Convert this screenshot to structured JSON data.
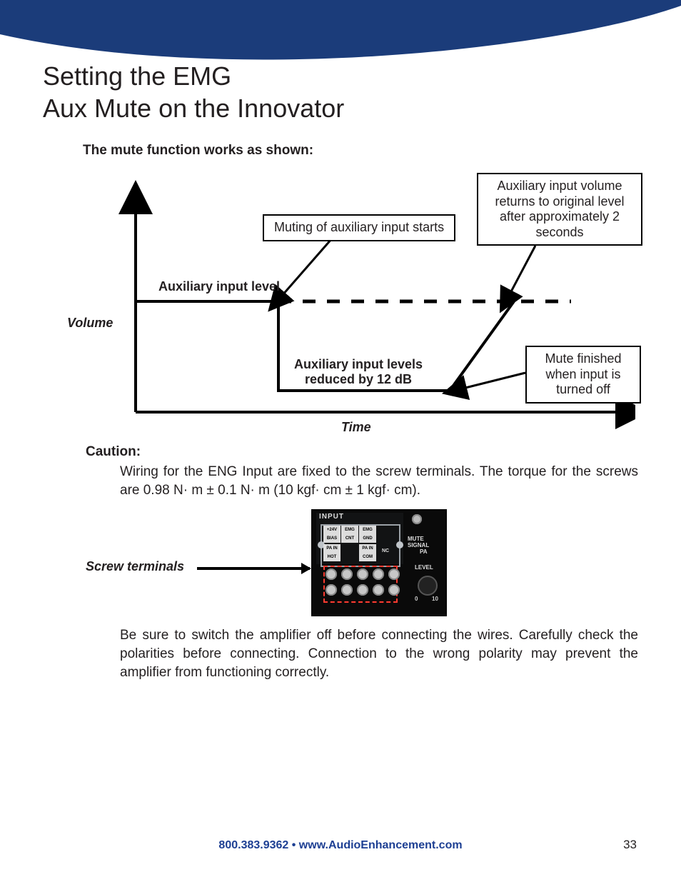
{
  "title_line1": "Setting the EMG",
  "title_line2": "Aux Mute on the Innovator",
  "intro": "The mute function works as shown:",
  "chart": {
    "y_label": "Volume",
    "x_label": "Time",
    "line_label": "Auxiliary input level",
    "callout_mute_start": "Muting of auxiliary input starts",
    "callout_return": "Auxiliary input volume returns to original level after approximately 2 seconds",
    "levels_reduced": "Auxiliary input levels reduced by 12 dB",
    "callout_mute_end": "Mute finished when input is turned off"
  },
  "caution": {
    "title": "Caution:",
    "text": "Wiring for the ENG Input are fixed to the screw terminals.  The torque for the screws are 0.98 N· m ± 0.1 N· m (10 kgf· cm ± 1 kgf· cm)."
  },
  "terminal_figure": {
    "label": "Screw terminals",
    "panel": {
      "input": "INPUT",
      "mute_signal": "MUTE SIGNAL",
      "pa": "PA",
      "level": "LEVEL",
      "scale_min": "0",
      "scale_max": "10",
      "row1": [
        "+24V",
        "EMG",
        "EMG"
      ],
      "row1b": [
        "BIAS",
        "CNT",
        "GND"
      ],
      "row2": [
        "PA IN",
        "PA IN"
      ],
      "row2b": [
        "HOT",
        "COM"
      ],
      "nc": "NC"
    }
  },
  "precaution": "Be sure to switch the amplifier off before connecting the wires. Carefully check the polarities before connecting. Connection to the wrong polarity may prevent the amplifier from functioning correctly.",
  "footer": {
    "phone": "800.383.9362",
    "sep": " • ",
    "url": "www.AudioEnhancement.com",
    "page": "33"
  },
  "chart_data": {
    "type": "line",
    "title": "Auxiliary input behavior when mute engaged",
    "xlabel": "Time",
    "ylabel": "Volume",
    "series": [
      {
        "name": "Auxiliary input level",
        "segments": [
          {
            "phase": "normal",
            "level_db": 0
          },
          {
            "phase": "muted",
            "level_db": -12
          },
          {
            "phase": "recovery",
            "duration_s": 2,
            "level_db_from": -12,
            "level_db_to": 0
          }
        ]
      }
    ],
    "annotations": [
      "Muting of auxiliary input starts",
      "Auxiliary input levels reduced by 12 dB",
      "Mute finished when input is turned off",
      "Auxiliary input volume returns to original level after approximately 2 seconds"
    ],
    "reduction_db": 12,
    "recovery_time_s": 2
  }
}
